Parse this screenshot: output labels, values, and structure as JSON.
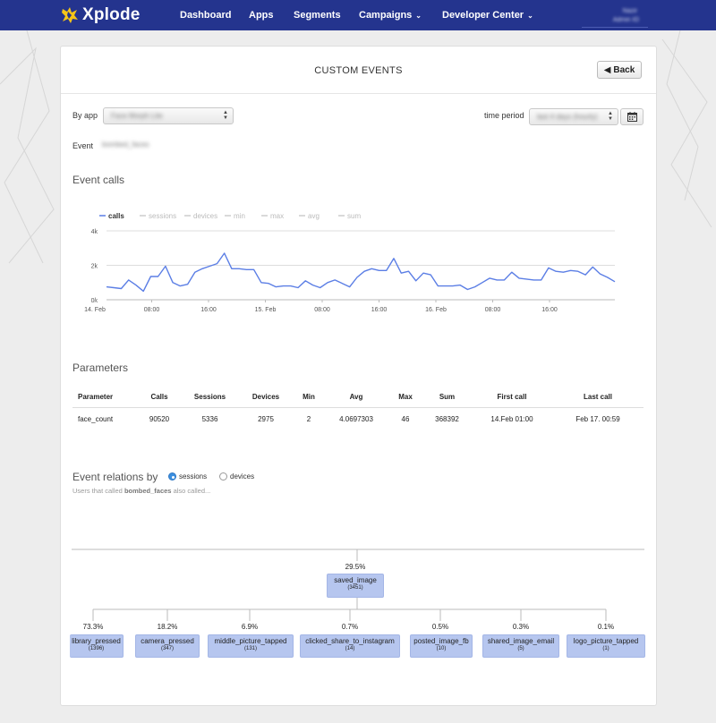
{
  "app": {
    "logo_text": "Xplode",
    "brand_color": "#24348e",
    "accent_color": "#f5c518"
  },
  "nav": {
    "items": [
      {
        "label": "Dashboard"
      },
      {
        "label": "Apps"
      },
      {
        "label": "Segments"
      },
      {
        "label": "Campaigns",
        "dropdown": true
      },
      {
        "label": "Developer Center",
        "dropdown": true
      }
    ],
    "user_name": "Nazir",
    "user_sub": "Admin IO"
  },
  "page": {
    "title": "CUSTOM EVENTS",
    "back_label": "Back"
  },
  "filters": {
    "by_app_label": "By app",
    "by_app_value": "Face Morph Lite",
    "time_period_label": "time period",
    "time_period_value": "last 4 days (hourly)",
    "event_label": "Event",
    "event_value": "bombed_faces"
  },
  "event_calls": {
    "title": "Event calls"
  },
  "chart_data": {
    "type": "line",
    "legend": [
      "calls",
      "sessions",
      "devices",
      "min",
      "max",
      "avg",
      "sum"
    ],
    "active_series": "calls",
    "y_ticks": [
      "0k",
      "2k",
      "4k"
    ],
    "ylim": [
      0,
      4000
    ],
    "x_ticks": [
      "14. Feb",
      "08:00",
      "16:00",
      "15. Feb",
      "08:00",
      "16:00",
      "16. Feb",
      "08:00",
      "16:00"
    ],
    "legend_position": "top-left",
    "grid": true,
    "line_color": "#5b7ee5",
    "series": [
      {
        "name": "calls",
        "values": [
          750,
          700,
          650,
          1150,
          850,
          500,
          1350,
          1350,
          1950,
          1000,
          800,
          900,
          1600,
          1800,
          1950,
          2100,
          2700,
          1800,
          1800,
          1750,
          1750,
          1000,
          950,
          750,
          800,
          800,
          700,
          1100,
          850,
          700,
          1000,
          1150,
          950,
          750,
          1300,
          1650,
          1800,
          1700,
          1700,
          2400,
          1550,
          1650,
          1100,
          1550,
          1450,
          800,
          800,
          800,
          850,
          600,
          750,
          1000,
          1250,
          1150,
          1150,
          1600,
          1250,
          1200,
          1150,
          1150,
          1850,
          1650,
          1600,
          1700,
          1650,
          1450,
          1900,
          1500,
          1300,
          1050
        ]
      }
    ]
  },
  "parameters": {
    "title": "Parameters",
    "headers": [
      "Parameter",
      "Calls",
      "Sessions",
      "Devices",
      "Min",
      "Avg",
      "Max",
      "Sum",
      "First call",
      "Last call"
    ],
    "rows": [
      [
        "face_count",
        "90520",
        "5336",
        "2975",
        "2",
        "4.0697303",
        "46",
        "368392",
        "14.Feb 01:00",
        "Feb 17. 00:59"
      ]
    ]
  },
  "relations": {
    "title": "Event relations by",
    "option_sessions": "sessions",
    "option_devices": "devices",
    "selected": "sessions",
    "subtext_prefix": "Users that called ",
    "subtext_event": "bombed_faces",
    "subtext_suffix": " also called...",
    "root": {
      "pct": "29.5%",
      "name": "saved_image",
      "count": "(3451)"
    },
    "children": [
      {
        "pct": "73.3%",
        "name": "library_pressed",
        "count": "(1396)"
      },
      {
        "pct": "18.2%",
        "name": "camera_pressed",
        "count": "(347)"
      },
      {
        "pct": "6.9%",
        "name": "middle_picture_tapped",
        "count": "(131)"
      },
      {
        "pct": "0.7%",
        "name": "clicked_share_to_instagram",
        "count": "(14)"
      },
      {
        "pct": "0.5%",
        "name": "posted_image_fb",
        "count": "(10)"
      },
      {
        "pct": "0.3%",
        "name": "shared_image_email",
        "count": "(5)"
      },
      {
        "pct": "0.1%",
        "name": "logo_picture_tapped",
        "count": "(1)"
      }
    ]
  }
}
